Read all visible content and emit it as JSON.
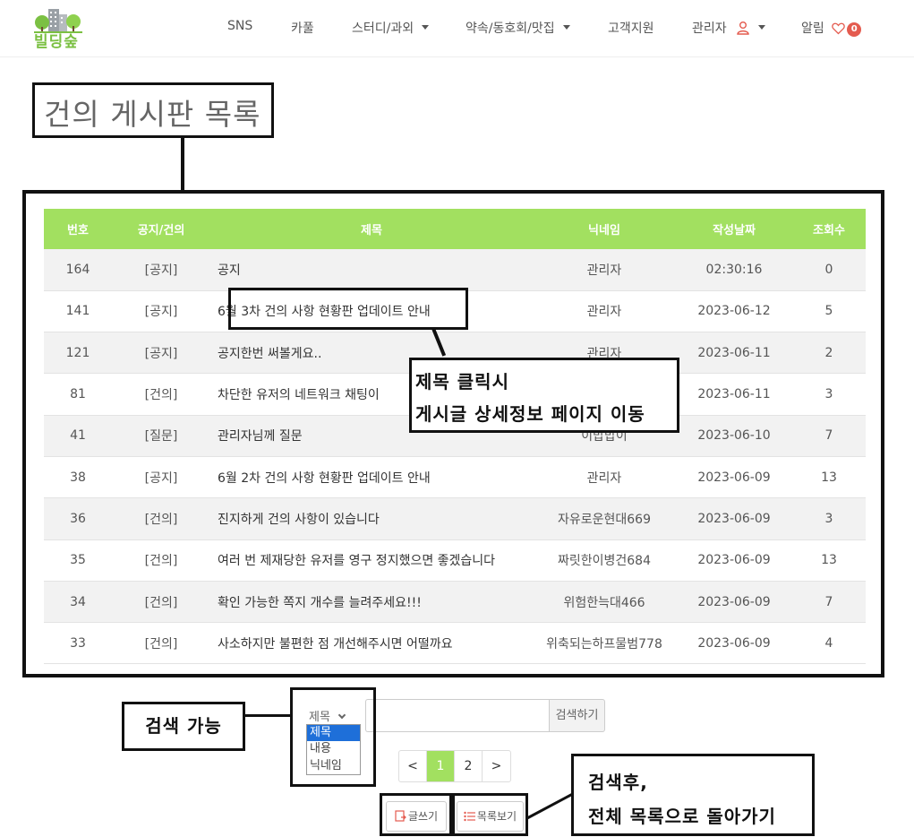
{
  "brand": {
    "logo_text": "빌딩숲"
  },
  "nav": {
    "items": [
      {
        "label": "SNS"
      },
      {
        "label": "카풀"
      },
      {
        "label": "스터디/과외"
      },
      {
        "label": "약속/동호회/맛집"
      },
      {
        "label": "고객지원"
      },
      {
        "label": "관리자"
      },
      {
        "label": "알림"
      }
    ],
    "notification_count": "0",
    "accent_color": "#e45b4f"
  },
  "page": {
    "title": "건의 게시판 목록",
    "accent_color": "#a2e060"
  },
  "table": {
    "headers": [
      "번호",
      "공지/건의",
      "제목",
      "닉네임",
      "작성날짜",
      "조회수"
    ],
    "rows": [
      {
        "no": "164",
        "type": "[공지]",
        "title": "공지",
        "nick": "관리자",
        "date": "02:30:16",
        "views": "0"
      },
      {
        "no": "141",
        "type": "[공지]",
        "title": "6월 3차 건의 사항 현황판 업데이트 안내",
        "nick": "관리자",
        "date": "2023-06-12",
        "views": "5"
      },
      {
        "no": "121",
        "type": "[공지]",
        "title": "공지한번 써볼게요..",
        "nick": "관리자",
        "date": "2023-06-11",
        "views": "2"
      },
      {
        "no": "81",
        "type": "[건의]",
        "title": "차단한 유저의 네트워크 채팅이",
        "nick": "",
        "date": "2023-06-11",
        "views": "3"
      },
      {
        "no": "41",
        "type": "[질문]",
        "title": "관리자님께 질문",
        "nick": "이밥밥이",
        "date": "2023-06-10",
        "views": "7"
      },
      {
        "no": "38",
        "type": "[공지]",
        "title": "6월 2차 건의 사항 현황판 업데이트 안내",
        "nick": "관리자",
        "date": "2023-06-09",
        "views": "13"
      },
      {
        "no": "36",
        "type": "[건의]",
        "title": "진지하게 건의 사항이 있습니다",
        "nick": "자유로운현대669",
        "date": "2023-06-09",
        "views": "3"
      },
      {
        "no": "35",
        "type": "[건의]",
        "title": "여러 번 제재당한 유저를 영구 정지했으면 좋겠습니다",
        "nick": "짜릿한이병건684",
        "date": "2023-06-09",
        "views": "13"
      },
      {
        "no": "34",
        "type": "[건의]",
        "title": "확인 가능한 쪽지 개수를 늘려주세요!!!",
        "nick": "위험한늑대466",
        "date": "2023-06-09",
        "views": "7"
      },
      {
        "no": "33",
        "type": "[건의]",
        "title": "사소하지만 불편한 점 개선해주시면 어떨까요",
        "nick": "위축되는하프물범778",
        "date": "2023-06-09",
        "views": "4"
      }
    ]
  },
  "annotations": {
    "title_click_line1": "제목 클릭시",
    "title_click_line2": "게시글 상세정보 페이지 이동",
    "search": "검색 가능",
    "back_line1": "검색후,",
    "back_line2": "전체 목록으로 돌아가기"
  },
  "search": {
    "selected": "제목",
    "options": [
      "제목",
      "내용",
      "닉네임"
    ],
    "input_value": "",
    "button_label": "검색하기"
  },
  "pagination": {
    "prev": "<",
    "pages": [
      "1",
      "2"
    ],
    "current": "1",
    "next": ">"
  },
  "buttons": {
    "write": "글쓰기",
    "list": "목록보기"
  }
}
